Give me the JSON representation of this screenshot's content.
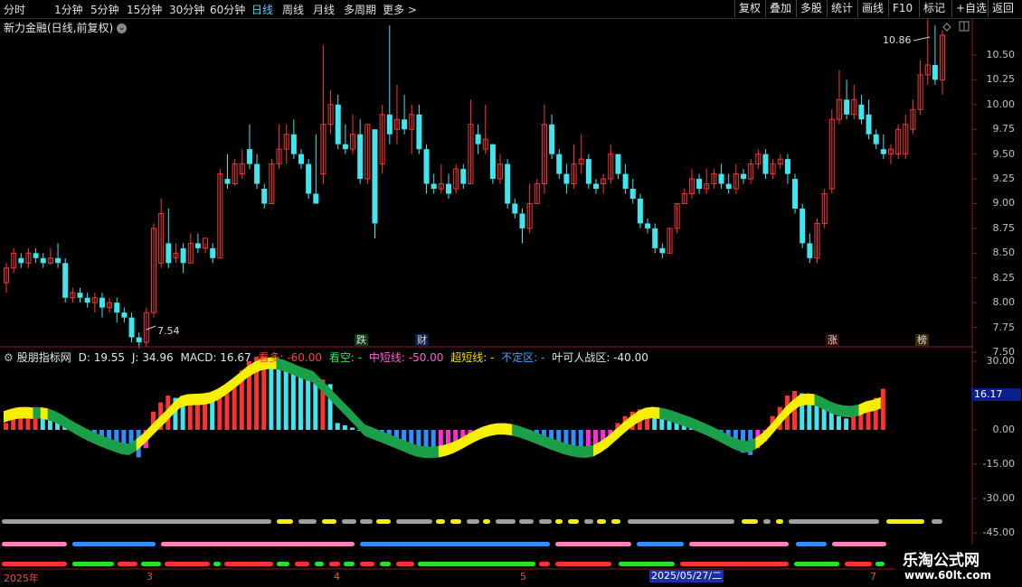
{
  "toolbar": {
    "tabs": [
      "分时",
      "1分钟",
      "5分钟",
      "15分钟",
      "30分钟",
      "60分钟",
      "日线",
      "周线",
      "月线",
      "多周期",
      "更多 >"
    ],
    "active_tab": "日线",
    "right_buttons": [
      "复权",
      "叠加",
      "多股",
      "统计",
      "画线",
      "F10",
      "标记",
      "+自选",
      "返回"
    ]
  },
  "stock": {
    "title": "新力金融(日线,前复权)",
    "high_label": "10.86",
    "low_label": "7.54"
  },
  "price_axis": [
    "10.50",
    "10.25",
    "10.00",
    "9.75",
    "9.50",
    "9.25",
    "9.00",
    "8.75",
    "8.50",
    "8.25",
    "8.00",
    "7.75",
    "7.50"
  ],
  "event_tags": [
    {
      "text": "跌",
      "color": "#1fc91f"
    },
    {
      "text": "财",
      "color": "#4f9dff"
    },
    {
      "text": "涨",
      "color": "#ff3b3b"
    },
    {
      "text": "榜",
      "color": "#f0c030"
    }
  ],
  "indicator": {
    "name": "股朋指标网",
    "d": "D: 19.55",
    "j": "J: 34.96",
    "macd": "MACD: 16.67",
    "kanduo": "看多: -60.00",
    "kankong": "看空: -",
    "zhongduan": "中短线: -50.00",
    "chaoduan": "超短线: -",
    "buding": "不定区: -",
    "yeke": "叶可人战区: -40.00",
    "current_value": "16.17"
  },
  "indicator_axis": [
    "30.00",
    "15.00",
    "0.00",
    "-15.00",
    "-30.00",
    "-45.00"
  ],
  "dates": [
    "2025年",
    "3",
    "4",
    "5",
    "2025/05/27/二",
    "7"
  ],
  "watermark": {
    "title": "乐淘公式网",
    "url": "www.60lt.com"
  },
  "colors": {
    "up": "#ff3232",
    "down": "#3fe6f0",
    "yellow": "#f5f000",
    "green": "#1aa048",
    "magenta": "#ff2bd6",
    "blue": "#2f8fff"
  },
  "chart_data": {
    "type": "candlestick",
    "candles": [
      [
        8.2,
        8.35,
        8.1,
        8.4
      ],
      [
        8.35,
        8.5,
        8.3,
        8.55
      ],
      [
        8.45,
        8.4,
        8.35,
        8.5
      ],
      [
        8.4,
        8.5,
        8.35,
        8.55
      ],
      [
        8.5,
        8.45,
        8.4,
        8.55
      ],
      [
        8.45,
        8.4,
        8.35,
        8.5
      ],
      [
        8.4,
        8.45,
        8.38,
        8.55
      ],
      [
        8.45,
        8.4,
        8.35,
        8.6
      ],
      [
        8.4,
        8.05,
        8.0,
        8.45
      ],
      [
        8.05,
        8.1,
        8.0,
        8.15
      ],
      [
        8.1,
        8.05,
        8.0,
        8.15
      ],
      [
        8.05,
        8.0,
        7.95,
        8.1
      ],
      [
        8.0,
        8.05,
        7.9,
        8.1
      ],
      [
        8.05,
        7.95,
        7.85,
        8.1
      ],
      [
        7.95,
        8.0,
        7.9,
        8.05
      ],
      [
        8.0,
        7.9,
        7.8,
        8.05
      ],
      [
        7.9,
        7.85,
        7.8,
        7.95
      ],
      [
        7.85,
        7.65,
        7.6,
        7.9
      ],
      [
        7.65,
        7.6,
        7.54,
        7.7
      ],
      [
        7.6,
        7.9,
        7.55,
        7.95
      ],
      [
        7.9,
        8.75,
        7.85,
        8.8
      ],
      [
        8.4,
        8.9,
        8.35,
        9.05
      ],
      [
        8.6,
        8.4,
        8.35,
        8.95
      ],
      [
        8.45,
        8.5,
        8.4,
        8.6
      ],
      [
        8.55,
        8.4,
        8.3,
        8.6
      ],
      [
        8.4,
        8.6,
        8.4,
        8.7
      ],
      [
        8.6,
        8.55,
        8.5,
        8.7
      ],
      [
        8.55,
        8.65,
        8.5,
        8.6
      ],
      [
        8.55,
        8.45,
        8.4,
        8.6
      ],
      [
        8.45,
        9.3,
        8.45,
        9.35
      ],
      [
        9.25,
        9.2,
        9.15,
        9.5
      ],
      [
        9.2,
        9.4,
        9.18,
        9.45
      ],
      [
        9.3,
        9.4,
        9.25,
        9.55
      ],
      [
        9.55,
        9.4,
        9.35,
        9.8
      ],
      [
        9.4,
        9.2,
        9.15,
        9.5
      ],
      [
        9.15,
        9.0,
        8.95,
        9.2
      ],
      [
        9.0,
        9.4,
        9.0,
        9.45
      ],
      [
        9.4,
        9.55,
        9.35,
        9.8
      ],
      [
        9.55,
        9.7,
        9.4,
        9.8
      ],
      [
        9.7,
        9.5,
        9.45,
        9.85
      ],
      [
        9.5,
        9.4,
        9.35,
        9.55
      ],
      [
        9.4,
        9.1,
        9.05,
        9.45
      ],
      [
        9.1,
        9.0,
        9.0,
        9.7
      ],
      [
        9.3,
        9.8,
        9.2,
        10.6
      ],
      [
        9.8,
        10.0,
        9.7,
        10.15
      ],
      [
        10.0,
        9.6,
        9.55,
        10.1
      ],
      [
        9.6,
        9.55,
        9.5,
        9.8
      ],
      [
        9.55,
        9.7,
        9.5,
        9.9
      ],
      [
        9.7,
        9.25,
        9.2,
        9.85
      ],
      [
        9.25,
        9.8,
        9.2,
        9.8
      ],
      [
        9.75,
        8.8,
        8.65,
        9.75
      ],
      [
        9.4,
        9.9,
        9.3,
        10.0
      ],
      [
        9.9,
        9.7,
        9.6,
        10.8
      ],
      [
        9.75,
        9.85,
        9.6,
        10.2
      ],
      [
        9.85,
        9.75,
        9.7,
        10.1
      ],
      [
        9.75,
        9.9,
        9.5,
        10.0
      ],
      [
        9.9,
        9.55,
        9.5,
        10.0
      ],
      [
        9.55,
        9.2,
        9.1,
        9.6
      ],
      [
        9.2,
        9.15,
        9.1,
        9.3
      ],
      [
        9.15,
        9.2,
        9.1,
        9.4
      ],
      [
        9.2,
        9.1,
        9.05,
        9.3
      ],
      [
        9.15,
        9.35,
        9.1,
        9.4
      ],
      [
        9.35,
        9.2,
        9.15,
        9.4
      ],
      [
        9.2,
        9.8,
        9.2,
        10.05
      ],
      [
        9.7,
        9.6,
        9.5,
        9.8
      ],
      [
        9.55,
        9.65,
        9.5,
        10.0
      ],
      [
        9.6,
        9.25,
        9.2,
        9.6
      ],
      [
        9.25,
        9.4,
        9.2,
        9.5
      ],
      [
        9.4,
        9.0,
        8.95,
        9.45
      ],
      [
        9.0,
        8.9,
        8.85,
        9.05
      ],
      [
        8.9,
        8.75,
        8.6,
        8.95
      ],
      [
        8.75,
        9.0,
        8.7,
        9.2
      ],
      [
        9.0,
        9.2,
        9.0,
        9.25
      ],
      [
        9.2,
        9.8,
        9.1,
        10.0
      ],
      [
        9.8,
        9.5,
        9.45,
        9.9
      ],
      [
        9.5,
        9.3,
        9.25,
        9.55
      ],
      [
        9.3,
        9.2,
        9.1,
        9.4
      ],
      [
        9.2,
        9.4,
        9.15,
        9.6
      ],
      [
        9.4,
        9.45,
        9.3,
        9.7
      ],
      [
        9.45,
        9.2,
        9.15,
        9.5
      ],
      [
        9.2,
        9.15,
        9.1,
        9.25
      ],
      [
        9.2,
        9.25,
        9.1,
        9.3
      ],
      [
        9.25,
        9.5,
        9.2,
        9.6
      ],
      [
        9.5,
        9.3,
        9.25,
        9.5
      ],
      [
        9.3,
        9.15,
        9.1,
        9.4
      ],
      [
        9.15,
        9.05,
        9.0,
        9.25
      ],
      [
        9.05,
        8.8,
        8.75,
        9.1
      ],
      [
        8.8,
        8.75,
        8.7,
        8.85
      ],
      [
        8.75,
        8.55,
        8.5,
        8.8
      ],
      [
        8.55,
        8.5,
        8.45,
        8.6
      ],
      [
        8.5,
        8.75,
        8.5,
        8.75
      ],
      [
        8.75,
        9.0,
        8.7,
        9.0
      ],
      [
        9.0,
        9.1,
        9.0,
        9.15
      ],
      [
        9.1,
        9.25,
        9.05,
        9.35
      ],
      [
        9.25,
        9.15,
        9.1,
        9.3
      ],
      [
        9.15,
        9.2,
        9.1,
        9.35
      ],
      [
        9.2,
        9.3,
        9.15,
        9.35
      ],
      [
        9.3,
        9.2,
        9.15,
        9.4
      ],
      [
        9.2,
        9.15,
        9.1,
        9.3
      ],
      [
        9.15,
        9.3,
        9.1,
        9.4
      ],
      [
        9.3,
        9.25,
        9.2,
        9.35
      ],
      [
        9.25,
        9.4,
        9.2,
        9.45
      ],
      [
        9.4,
        9.5,
        9.35,
        9.55
      ],
      [
        9.5,
        9.3,
        9.25,
        9.55
      ],
      [
        9.3,
        9.4,
        9.25,
        9.45
      ],
      [
        9.4,
        9.45,
        9.35,
        9.5
      ],
      [
        9.45,
        9.3,
        9.2,
        9.5
      ],
      [
        9.25,
        8.95,
        8.9,
        9.3
      ],
      [
        8.95,
        8.6,
        8.55,
        9.0
      ],
      [
        8.6,
        8.45,
        8.4,
        8.7
      ],
      [
        8.45,
        8.8,
        8.4,
        8.85
      ],
      [
        8.8,
        9.1,
        8.75,
        9.15
      ],
      [
        9.15,
        9.85,
        9.1,
        9.95
      ],
      [
        9.85,
        10.05,
        9.8,
        10.35
      ],
      [
        10.05,
        9.9,
        9.85,
        10.25
      ],
      [
        9.9,
        10.05,
        9.85,
        10.2
      ],
      [
        10.0,
        9.85,
        9.8,
        10.1
      ],
      [
        9.9,
        9.7,
        9.65,
        10.05
      ],
      [
        9.7,
        9.6,
        9.55,
        9.75
      ],
      [
        9.55,
        9.5,
        9.45,
        9.7
      ],
      [
        9.5,
        9.55,
        9.4,
        9.6
      ],
      [
        9.5,
        9.75,
        9.45,
        9.8
      ],
      [
        9.5,
        9.8,
        9.45,
        9.9
      ],
      [
        9.75,
        9.95,
        9.7,
        10.05
      ],
      [
        9.95,
        10.3,
        9.9,
        10.45
      ],
      [
        10.3,
        10.4,
        10.2,
        10.86
      ],
      [
        10.4,
        10.25,
        10.2,
        10.8
      ],
      [
        10.25,
        10.7,
        10.1,
        10.75
      ]
    ],
    "macd_hist": [
      3,
      6,
      8,
      10,
      10,
      8,
      6,
      4,
      2,
      0,
      -2,
      -4,
      -5,
      -6,
      -7,
      -8,
      -9,
      -10,
      -12,
      -8,
      8,
      12,
      15,
      14,
      12,
      12,
      13,
      14,
      13,
      16,
      18,
      22,
      26,
      30,
      32,
      32,
      30,
      28,
      26,
      25,
      24,
      23,
      22,
      22,
      20,
      3,
      2,
      1,
      0,
      -1,
      -2,
      -4,
      -6,
      -7,
      -8,
      -9,
      -10,
      -12,
      -12,
      -10,
      -8,
      -6,
      -4,
      -2,
      -1,
      1,
      2,
      2,
      1,
      0,
      -2,
      -4,
      -5,
      -6,
      -7,
      -8,
      -9,
      -10,
      -12,
      -11,
      -10,
      -8,
      -4,
      3,
      6,
      8,
      9,
      9,
      8,
      7,
      6,
      4,
      3,
      2,
      1,
      0,
      -2,
      -4,
      -6,
      -8,
      -10,
      -11,
      -8,
      -5,
      6,
      10,
      15,
      17,
      16,
      14,
      12,
      10,
      8,
      6,
      5,
      7,
      9,
      11,
      14,
      18
    ],
    "y_axis_price": [
      7.5,
      10.6
    ],
    "y_axis_indicator": [
      -45,
      30
    ]
  }
}
